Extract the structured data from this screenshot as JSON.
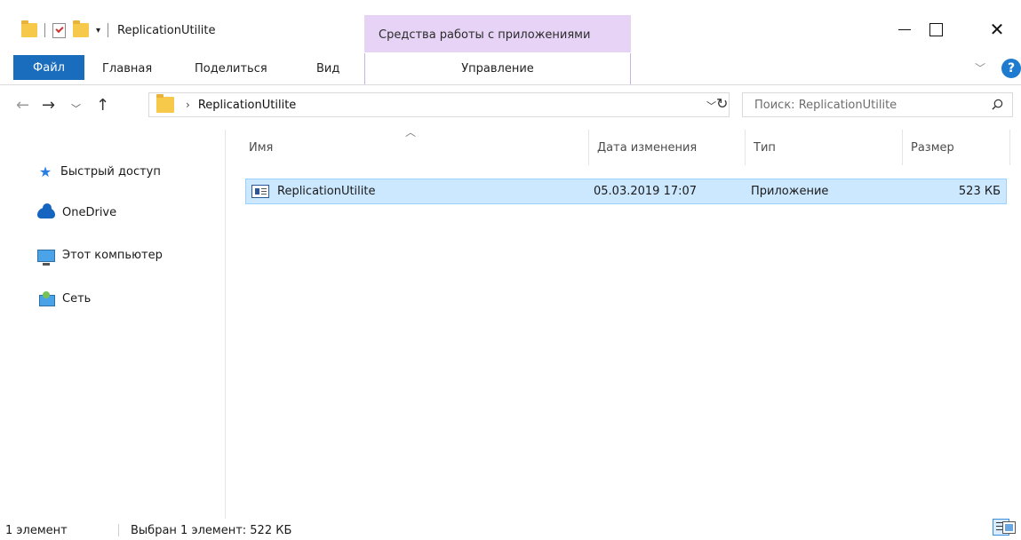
{
  "window": {
    "title": "ReplicationUtilite",
    "context_tab_group": "Средства работы с приложениями"
  },
  "ribbon": {
    "tabs": [
      "Файл",
      "Главная",
      "Поделиться",
      "Вид",
      "Управление"
    ]
  },
  "address": {
    "path": [
      "ReplicationUtilite"
    ],
    "search_placeholder": "Поиск: ReplicationUtilite"
  },
  "navigation": {
    "items": [
      "Быстрый доступ",
      "OneDrive",
      "Этот компьютер",
      "Сеть"
    ]
  },
  "file_list": {
    "columns": [
      "Имя",
      "Дата изменения",
      "Тип",
      "Размер"
    ],
    "sort_column": "Имя",
    "rows": [
      {
        "name": "ReplicationUtilite",
        "date": "05.03.2019 17:07",
        "type": "Приложение",
        "size": "523 КБ",
        "selected": true
      }
    ]
  },
  "status": {
    "count": "1 элемент",
    "selection": "Выбран 1 элемент: 522 КБ"
  },
  "colors": {
    "file_tab": "#1a6dbd",
    "context_tab": "#e6d3f5",
    "selection_bg": "#cce8ff",
    "selection_border": "#99d1ff"
  }
}
